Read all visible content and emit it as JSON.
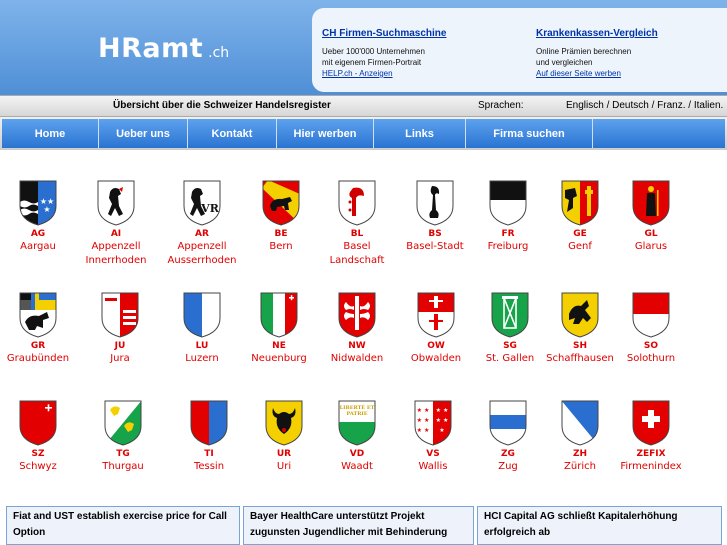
{
  "logo": {
    "main": "HRamt",
    "suffix": ".ch"
  },
  "promo": {
    "col1": {
      "title": "CH Firmen-Suchmaschine",
      "line1": "Ueber 100'000 Unternehmen",
      "line2": "mit eigenem Firmen-Portrait",
      "link": "HELP.ch - Anzeigen"
    },
    "col2": {
      "title": "Krankenkassen-Vergleich",
      "line1": "Online Prämien berechnen",
      "line2": "und vergleichen",
      "link": "Auf dieser Seite werben"
    }
  },
  "subbar": {
    "overview": "Übersicht über die Schweizer Handelsregister",
    "lang_label": "Sprachen:",
    "languages": "Englisch / Deutsch / Franz. / Italien."
  },
  "nav": [
    "Home",
    "Ueber uns",
    "Kontakt",
    "Hier werben",
    "Links",
    "Firma suchen",
    ""
  ],
  "cantons": [
    {
      "code": "AG",
      "name": "Aargau",
      "name2": ""
    },
    {
      "code": "AI",
      "name": "Appenzell",
      "name2": "Innerrhoden"
    },
    {
      "code": "AR",
      "name": "Appenzell",
      "name2": "Ausserrhoden"
    },
    {
      "code": "BE",
      "name": "Bern",
      "name2": ""
    },
    {
      "code": "BL",
      "name": "Basel",
      "name2": "Landschaft"
    },
    {
      "code": "BS",
      "name": "Basel-Stadt",
      "name2": ""
    },
    {
      "code": "FR",
      "name": "Freiburg",
      "name2": ""
    },
    {
      "code": "GE",
      "name": "Genf",
      "name2": ""
    },
    {
      "code": "GL",
      "name": "Glarus",
      "name2": ""
    },
    {
      "code": "GR",
      "name": "Graubünden",
      "name2": ""
    },
    {
      "code": "JU",
      "name": "Jura",
      "name2": ""
    },
    {
      "code": "LU",
      "name": "Luzern",
      "name2": ""
    },
    {
      "code": "NE",
      "name": "Neuenburg",
      "name2": ""
    },
    {
      "code": "NW",
      "name": "Nidwalden",
      "name2": ""
    },
    {
      "code": "OW",
      "name": "Obwalden",
      "name2": ""
    },
    {
      "code": "SG",
      "name": "St. Gallen",
      "name2": ""
    },
    {
      "code": "SH",
      "name": "Schaffhausen",
      "name2": ""
    },
    {
      "code": "SO",
      "name": "Solothurn",
      "name2": ""
    },
    {
      "code": "SZ",
      "name": "Schwyz",
      "name2": ""
    },
    {
      "code": "TG",
      "name": "Thurgau",
      "name2": ""
    },
    {
      "code": "TI",
      "name": "Tessin",
      "name2": ""
    },
    {
      "code": "UR",
      "name": "Uri",
      "name2": ""
    },
    {
      "code": "VD",
      "name": "Waadt",
      "name2": ""
    },
    {
      "code": "VS",
      "name": "Wallis",
      "name2": ""
    },
    {
      "code": "ZG",
      "name": "Zug",
      "name2": ""
    },
    {
      "code": "ZH",
      "name": "Zürich",
      "name2": ""
    },
    {
      "code": "ZEFIX",
      "name": "Firmenindex",
      "name2": ""
    }
  ],
  "shield_texts": {
    "vd": "LIBERTÉ ET PATRIE"
  },
  "news": [
    "Fiat and UST establish exercise price for Call Option",
    "Bayer HealthCare unterstützt Projekt zugunsten Jugendlicher mit Behinderung",
    "HCI Capital AG schließt Kapitalerhöhung erfolgreich ab"
  ],
  "colors": {
    "red": "#e00000",
    "blue": "#2a74d2"
  }
}
